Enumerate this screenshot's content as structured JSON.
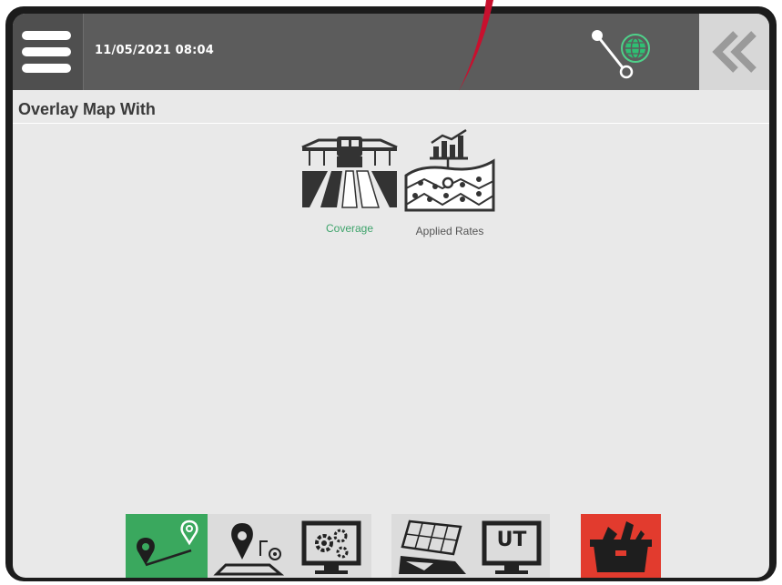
{
  "header": {
    "datetime": "11/05/2021 08:04"
  },
  "page": {
    "title": "Overlay Map With"
  },
  "overlay_options": [
    {
      "label": "Coverage",
      "selected": true
    },
    {
      "label": "Applied Rates",
      "selected": false
    }
  ],
  "taskbar": {
    "buttons": [
      {
        "icon": "guidance-icon",
        "active": true
      },
      {
        "icon": "field-map-icon",
        "active": false
      },
      {
        "icon": "console-settings-icon",
        "active": false
      },
      {
        "icon": "implement-map-icon",
        "active": false
      },
      {
        "icon": "ut-icon",
        "active": false,
        "text": "UT"
      },
      {
        "icon": "toolbox-icon",
        "active": false
      }
    ]
  },
  "colors": {
    "topbar": "#5c5c5c",
    "accent_green": "#3fa46c",
    "active_button": "#3aa85e",
    "toolbox_red": "#e23b2e",
    "background": "#e9e9e9"
  }
}
